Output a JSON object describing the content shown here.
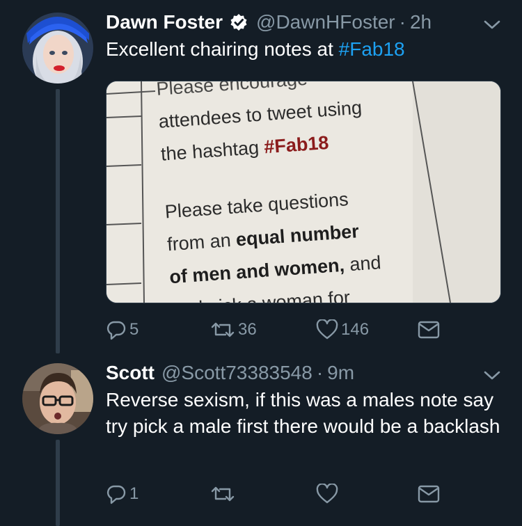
{
  "tweets": [
    {
      "name": "Dawn Foster",
      "verified": true,
      "handle": "@DawnHFoster",
      "dot": "·",
      "time": "2h",
      "text_before": "Excellent chairing notes at ",
      "hashtag": "#Fab18",
      "media": {
        "line_top": "Please encourage",
        "line1": "attendees to tweet using",
        "line2_prefix": "the hashtag ",
        "line2_tag": "#Fab18",
        "line3": "Please take questions",
        "line4_prefix": "from an ",
        "line4_bold": "equal number",
        "line5_bold": "of men and women,",
        "line5_suffix": " and",
        "line6": "and pick a woman for"
      },
      "replies": "5",
      "retweets": "36",
      "likes": "146"
    },
    {
      "name": "Scott",
      "verified": false,
      "handle": "@Scott73383548",
      "dot": "·",
      "time": "9m",
      "text": "Reverse sexism, if this was a males note say try pick a male first there would be a backlash",
      "replies": "1",
      "retweets": "",
      "likes": ""
    }
  ],
  "icons": {
    "reply": "reply-icon",
    "retweet": "retweet-icon",
    "like": "heart-icon",
    "dm": "envelope-icon",
    "more": "chevron-down-icon",
    "verified": "verified-badge-icon"
  },
  "colors": {
    "background": "#141d26",
    "text": "#ffffff",
    "secondary": "#8899a6",
    "link": "#1da1f2",
    "thread_line": "#2f3d4a"
  }
}
